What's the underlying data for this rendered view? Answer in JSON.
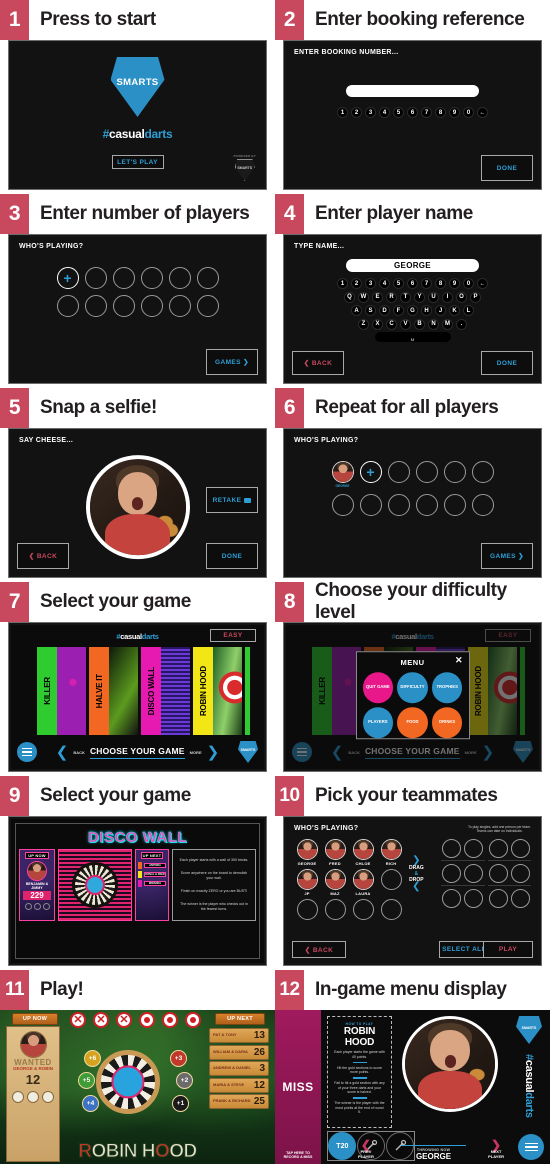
{
  "brand": {
    "hashtag_prefix": "#",
    "hashtag_casual": "casual",
    "hashtag_darts": "darts",
    "logo_text": "SMARTS",
    "powered_by": "POWERED BY",
    "accent_blue": "#2e9fd6",
    "accent_red": "#c8485e",
    "accent_pink": "#ff3fa4",
    "accent_orange": "#f26722"
  },
  "panels": [
    {
      "number": "1",
      "title": "Press to start"
    },
    {
      "number": "2",
      "title": "Enter booking reference"
    },
    {
      "number": "3",
      "title": "Enter number of players"
    },
    {
      "number": "4",
      "title": "Enter player name"
    },
    {
      "number": "5",
      "title": "Snap a selfie!"
    },
    {
      "number": "6",
      "title": "Repeat for all players"
    },
    {
      "number": "7",
      "title": "Select your game"
    },
    {
      "number": "8",
      "title": "Choose your difficulty level"
    },
    {
      "number": "9",
      "title": "Select your game"
    },
    {
      "number": "10",
      "title": "Pick your teammates"
    },
    {
      "number": "11",
      "title": "Play!"
    },
    {
      "number": "12",
      "title": "In-game menu display"
    }
  ],
  "p1": {
    "cta": "LET'S PLAY"
  },
  "p2": {
    "prompt": "ENTER BOOKING NUMBER...",
    "input_value": "",
    "keys": [
      "1",
      "2",
      "3",
      "4",
      "5",
      "6",
      "7",
      "8",
      "9",
      "0"
    ],
    "backspace": "←",
    "done": "DONE"
  },
  "p3": {
    "prompt": "WHO'S PLAYING?",
    "add_icon": "+",
    "games_button": "GAMES ❯",
    "slots_row1": 6,
    "slots_row2": 6
  },
  "p4": {
    "prompt": "TYPE NAME...",
    "input_value": "GEORGE",
    "row_numbers": [
      "1",
      "2",
      "3",
      "4",
      "5",
      "6",
      "7",
      "8",
      "9",
      "0"
    ],
    "backspace": "←",
    "row_q": [
      "Q",
      "W",
      "E",
      "R",
      "T",
      "Y",
      "U",
      "I",
      "O",
      "P"
    ],
    "row_a": [
      "A",
      "S",
      "D",
      "F",
      "G",
      "H",
      "J",
      "K",
      "L"
    ],
    "row_z": [
      "Z",
      "X",
      "C",
      "V",
      "B",
      "N",
      "M",
      "."
    ],
    "space": "␣",
    "back": "❮ BACK",
    "done": "DONE"
  },
  "p5": {
    "prompt": "SAY CHEESE...",
    "retake": "RETAKE",
    "retake_icon": "camera-icon",
    "back": "❮ BACK",
    "done": "DONE"
  },
  "p6": {
    "prompt": "WHO'S PLAYING?",
    "player_name": "GEORGE",
    "add_icon": "+",
    "games_button": "GAMES ❯"
  },
  "p7": {
    "difficulty_badge": "EASY",
    "games": [
      {
        "name": "KILLER",
        "spine_color": "#2ecc2e",
        "art_color": "#9b1fb0"
      },
      {
        "name": "HALVE IT",
        "spine_color": "#f26722",
        "art_color": "#1d3b10"
      },
      {
        "name": "DISCO WALL",
        "spine_color": "#e619b0",
        "art_color": "#4a2aa8"
      },
      {
        "name": "ROBIN HOOD",
        "spine_color": "#f2e616",
        "art_color": "#1f5d24"
      }
    ],
    "nav_back": "BACK",
    "nav_label": "CHOOSE YOUR GAME",
    "nav_more": "MORE",
    "menu_icon": "hamburger-icon"
  },
  "p8": {
    "modal_title": "MENU",
    "close_icon": "✕",
    "buttons": [
      {
        "label": "QUIT GAME",
        "color": "#e8188a"
      },
      {
        "label": "DIFFICULTY",
        "color": "#2b90c6"
      },
      {
        "label": "TROPHIES",
        "color": "#2b90c6"
      },
      {
        "label": "PLAYERS",
        "color": "#2b90c6"
      },
      {
        "label": "FOOD",
        "color": "#f26722"
      },
      {
        "label": "DRINKS",
        "color": "#f26722"
      }
    ],
    "bg_difficulty_badge": "EASY",
    "bg_nav_label": "CHOOSE YOUR GAME",
    "bg_nav_back": "BACK",
    "bg_nav_more": "MORE"
  },
  "p9": {
    "game_title": "DISCO WALL",
    "up_now": "UP NOW",
    "up_now_team": "BENJAMIN & JIMMY",
    "up_now_score": "229",
    "up_next": "UP NEXT",
    "next_rows": [
      {
        "team": "ANTONIA",
        "color": "#f26722"
      },
      {
        "team": "DONAL & FRED",
        "color": "#f2e616"
      },
      {
        "team": "MIRANDA",
        "color": "#e619b0"
      }
    ],
    "rules": [
      "Each player starts with a wall of 300 bricks.",
      "Score anywhere on the board to demolish your wall.",
      "Finish on exactly ZERO or you are BUST!",
      "The winner is the player who checks out in the fewest turns."
    ]
  },
  "p10": {
    "prompt": "WHO'S PLAYING?",
    "hint_line1": "To play singles, add one person per team.",
    "hint_line2": "Teams can take on individuals.",
    "players": [
      "GEORGE",
      "FRED",
      "CHLOE",
      "RICH",
      "JP",
      "MAZ",
      "LAURA"
    ],
    "drag_line1": "DRAG",
    "drag_amp": "&",
    "drag_line2": "DROP",
    "back": "❮ BACK",
    "select_all": "SELECT ALL",
    "play": "PLAY"
  },
  "p11": {
    "up_now": "UP NOW",
    "up_next": "UP NEXT",
    "wanted": "WANTED",
    "current_team": "GEORGE & ROBIN",
    "current_score": "12",
    "game_title_part1": "R",
    "game_title_part2": "BIN H",
    "game_title_part3": "D",
    "game_title_full": "ROBIN HOOD",
    "bubbles": [
      {
        "label": "+6",
        "color": "#d6a21f"
      },
      {
        "label": "+5",
        "color": "#3f9b35"
      },
      {
        "label": "+4",
        "color": "#3b72c4"
      },
      {
        "label": "+3",
        "color": "#c0392b"
      },
      {
        "label": "+2",
        "color": "#6b6b6b"
      },
      {
        "label": "+1",
        "color": "#1a1a1a"
      }
    ],
    "round_icons": [
      "x-icon",
      "x-icon",
      "x-icon",
      "target-icon",
      "target-icon",
      "target-icon"
    ],
    "queue": [
      {
        "team": "PAT & TONY",
        "score": "13"
      },
      {
        "team": "WILLIAM & DARIA",
        "score": "26"
      },
      {
        "team": "ANDREW & DANIEL",
        "score": "3"
      },
      {
        "team": "MARIA & STEVE",
        "score": "12"
      },
      {
        "team": "FRANK & RICHARD",
        "score": "25"
      }
    ]
  },
  "p12": {
    "miss_label": "MISS",
    "miss_sub_line1": "TAP HERE TO",
    "miss_sub_line2": "RECORD A MISS",
    "rule_kicker": "HOW TO PLAY",
    "rule_title": "ROBIN HOOD",
    "rules": [
      "Each player starts the game with 40 points.",
      "Hit the gold sections to score more points.",
      "Fail to hit a gold section with any of your three darts and your score is halved.",
      "The winner is the player with the most points at the end of round 5."
    ],
    "dart_chips": [
      "T20",
      "dart-icon",
      "dart-icon"
    ],
    "prev_player_line1": "PREV",
    "prev_player_line2": "PLAYER",
    "next_player_line1": "NEXT",
    "next_player_line2": "PLAYER",
    "throwing_now_label": "THROWING NOW",
    "throwing_now_name": "GEORGE",
    "menu_icon": "hamburger-icon",
    "logo_text": "SMARTS"
  }
}
